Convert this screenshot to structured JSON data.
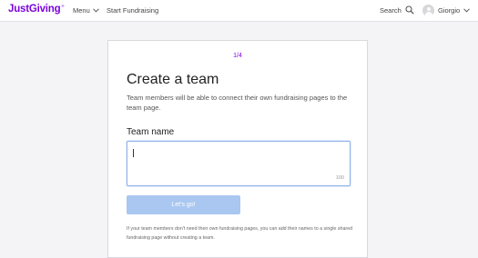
{
  "nav": {
    "logo": "JustGiving",
    "logo_mark": "®",
    "menu_label": "Menu",
    "start_fundraising": "Start Fundraising",
    "search_label": "Search",
    "user_name": "Giorgio"
  },
  "colors": {
    "brand": "#7a04dd",
    "button": "#a9c7f0",
    "input_focus": "#8fb2e8"
  },
  "card": {
    "step": "1/4",
    "title": "Create a team",
    "description": "Team members will be able to connect their own fundraising pages to the team page.",
    "field_label": "Team name",
    "field_value": "",
    "char_limit": "100",
    "button_label": "Let's go!",
    "note": "If your team members don't need their own fundraising pages, you can add their names to a single shared fundraising page without creating a team."
  }
}
